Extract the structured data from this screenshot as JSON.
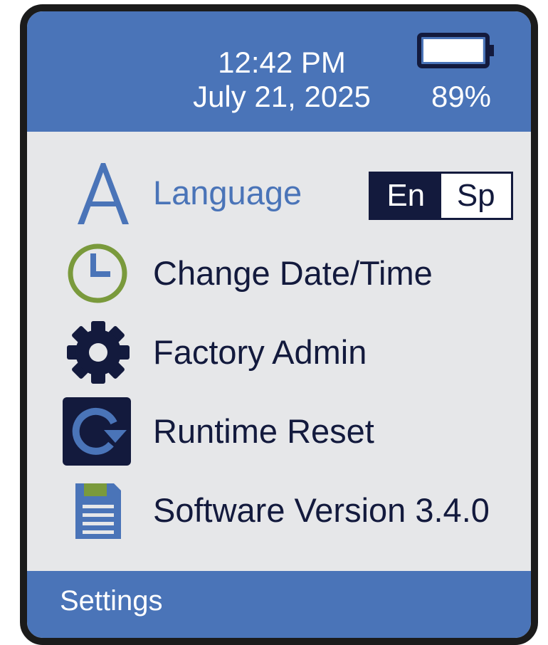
{
  "status": {
    "time": "12:42 PM",
    "date": "July 21, 2025",
    "battery_percent": "89%",
    "battery_level": 0.89
  },
  "menu": {
    "items": [
      {
        "label": "Language",
        "icon": "letter-a-icon"
      },
      {
        "label": "Change Date/Time",
        "icon": "clock-icon"
      },
      {
        "label": "Factory Admin",
        "icon": "gear-icon"
      },
      {
        "label": "Runtime Reset",
        "icon": "reset-icon"
      },
      {
        "label": "Software Version 3.4.0",
        "icon": "floppy-disk-icon"
      }
    ],
    "language_options": [
      "En",
      "Sp"
    ],
    "language_selected": "En"
  },
  "footer": {
    "title": "Settings"
  },
  "colors": {
    "accent_blue": "#4a74b8",
    "navy": "#131a3d",
    "clock_green": "#7a9a3c",
    "background": "#e6e7e9"
  }
}
